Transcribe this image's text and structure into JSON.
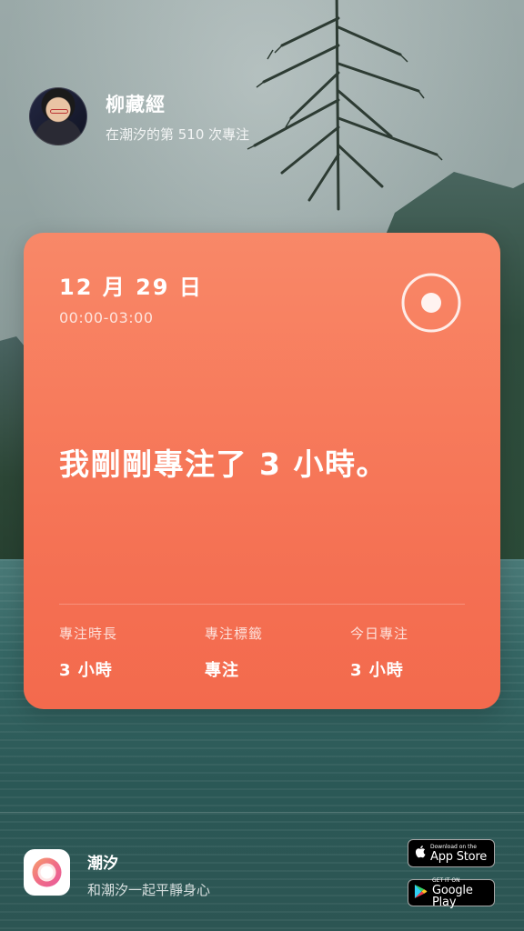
{
  "user": {
    "name": "柳藏經",
    "subtitle": "在潮汐的第 510 次專注"
  },
  "card": {
    "date": "12 月 29 日",
    "time_range": "00:00-03:00",
    "headline": "我剛剛專注了 3 小時。",
    "stats": [
      {
        "label": "專注時長",
        "value": "3 小時"
      },
      {
        "label": "專注標籤",
        "value": "專注"
      },
      {
        "label": "今日專注",
        "value": "3 小時"
      }
    ],
    "accent_color": "#f6785a"
  },
  "footer": {
    "app_name": "潮汐",
    "slogan": "和潮汐一起平靜身心",
    "app_store": {
      "small": "Download on the",
      "big": "App Store"
    },
    "google_play": {
      "small": "GET IT ON",
      "big": "Google Play"
    }
  }
}
